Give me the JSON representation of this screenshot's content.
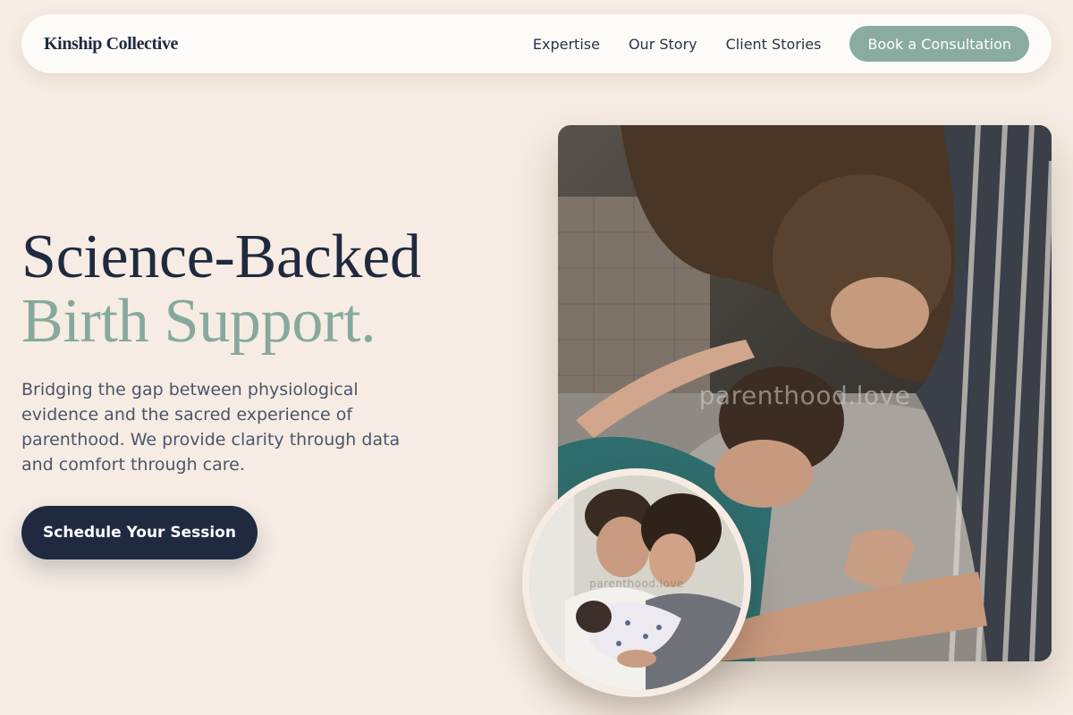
{
  "nav": {
    "logo": "Kinship Collective",
    "links": [
      "Expertise",
      "Our Story",
      "Client Stories"
    ],
    "cta": "Book a Consultation"
  },
  "hero": {
    "title_line1": "Science-Backed",
    "title_line2": "Birth Support.",
    "description": "Bridging the gap between physiological evidence and the sacred experience of parenthood. We provide clarity through data and comfort through care.",
    "cta": "Schedule Your Session"
  },
  "images": {
    "main_watermark": "parenthood.love",
    "inset_watermark": "parenthood.love"
  },
  "colors": {
    "background": "#f6ece3",
    "navy": "#1f2a40",
    "sage": "#86a99c",
    "nav_cta": "#8aab9f"
  }
}
